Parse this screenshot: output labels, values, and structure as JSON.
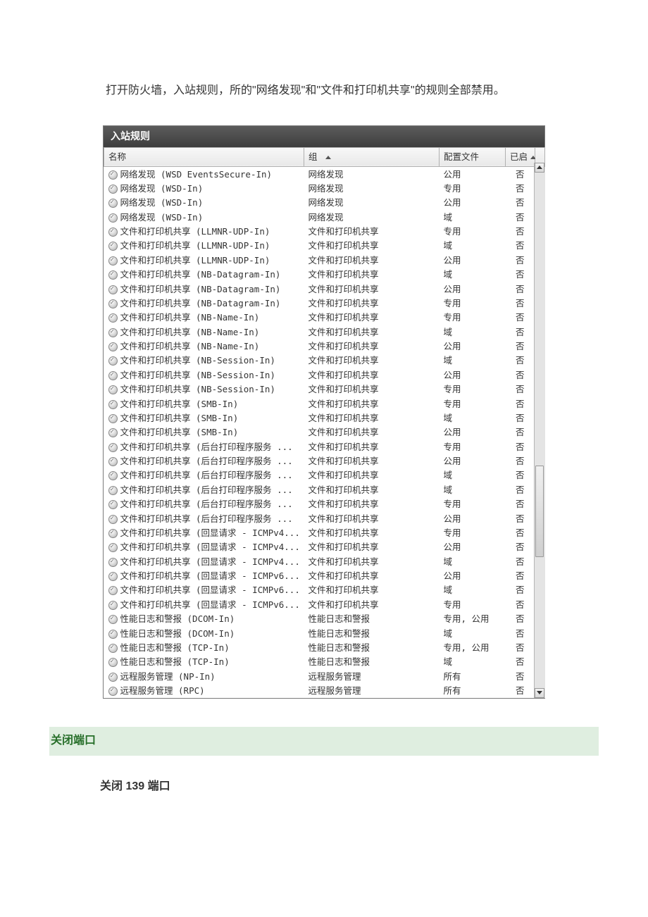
{
  "intro": "打开防火墙，入站规则，所的\"网络发现\"和\"文件和打印机共享\"的规则全部禁用。",
  "panelTitle": "入站规则",
  "headers": {
    "name": "名称",
    "group": "组",
    "profile": "配置文件",
    "enabled": "已启"
  },
  "rules": [
    {
      "name": "网络发现 (WSD EventsSecure-In)",
      "group": "网络发现",
      "profile": "公用",
      "enabled": "否"
    },
    {
      "name": "网络发现 (WSD-In)",
      "group": "网络发现",
      "profile": "专用",
      "enabled": "否"
    },
    {
      "name": "网络发现 (WSD-In)",
      "group": "网络发现",
      "profile": "公用",
      "enabled": "否"
    },
    {
      "name": "网络发现 (WSD-In)",
      "group": "网络发现",
      "profile": "域",
      "enabled": "否"
    },
    {
      "name": "文件和打印机共享 (LLMNR-UDP-In)",
      "group": "文件和打印机共享",
      "profile": "专用",
      "enabled": "否"
    },
    {
      "name": "文件和打印机共享 (LLMNR-UDP-In)",
      "group": "文件和打印机共享",
      "profile": "域",
      "enabled": "否"
    },
    {
      "name": "文件和打印机共享 (LLMNR-UDP-In)",
      "group": "文件和打印机共享",
      "profile": "公用",
      "enabled": "否"
    },
    {
      "name": "文件和打印机共享 (NB-Datagram-In)",
      "group": "文件和打印机共享",
      "profile": "域",
      "enabled": "否"
    },
    {
      "name": "文件和打印机共享 (NB-Datagram-In)",
      "group": "文件和打印机共享",
      "profile": "公用",
      "enabled": "否"
    },
    {
      "name": "文件和打印机共享 (NB-Datagram-In)",
      "group": "文件和打印机共享",
      "profile": "专用",
      "enabled": "否"
    },
    {
      "name": "文件和打印机共享 (NB-Name-In)",
      "group": "文件和打印机共享",
      "profile": "专用",
      "enabled": "否"
    },
    {
      "name": "文件和打印机共享 (NB-Name-In)",
      "group": "文件和打印机共享",
      "profile": "域",
      "enabled": "否"
    },
    {
      "name": "文件和打印机共享 (NB-Name-In)",
      "group": "文件和打印机共享",
      "profile": "公用",
      "enabled": "否"
    },
    {
      "name": "文件和打印机共享 (NB-Session-In)",
      "group": "文件和打印机共享",
      "profile": "域",
      "enabled": "否"
    },
    {
      "name": "文件和打印机共享 (NB-Session-In)",
      "group": "文件和打印机共享",
      "profile": "公用",
      "enabled": "否"
    },
    {
      "name": "文件和打印机共享 (NB-Session-In)",
      "group": "文件和打印机共享",
      "profile": "专用",
      "enabled": "否"
    },
    {
      "name": "文件和打印机共享 (SMB-In)",
      "group": "文件和打印机共享",
      "profile": "专用",
      "enabled": "否"
    },
    {
      "name": "文件和打印机共享 (SMB-In)",
      "group": "文件和打印机共享",
      "profile": "域",
      "enabled": "否"
    },
    {
      "name": "文件和打印机共享 (SMB-In)",
      "group": "文件和打印机共享",
      "profile": "公用",
      "enabled": "否"
    },
    {
      "name": "文件和打印机共享 (后台打印程序服务 ...",
      "group": "文件和打印机共享",
      "profile": "专用",
      "enabled": "否"
    },
    {
      "name": "文件和打印机共享 (后台打印程序服务 ...",
      "group": "文件和打印机共享",
      "profile": "公用",
      "enabled": "否"
    },
    {
      "name": "文件和打印机共享 (后台打印程序服务 ...",
      "group": "文件和打印机共享",
      "profile": "域",
      "enabled": "否"
    },
    {
      "name": "文件和打印机共享 (后台打印程序服务 ...",
      "group": "文件和打印机共享",
      "profile": "域",
      "enabled": "否"
    },
    {
      "name": "文件和打印机共享 (后台打印程序服务 ...",
      "group": "文件和打印机共享",
      "profile": "专用",
      "enabled": "否"
    },
    {
      "name": "文件和打印机共享 (后台打印程序服务 ...",
      "group": "文件和打印机共享",
      "profile": "公用",
      "enabled": "否"
    },
    {
      "name": "文件和打印机共享 (回显请求 - ICMPv4...",
      "group": "文件和打印机共享",
      "profile": "专用",
      "enabled": "否"
    },
    {
      "name": "文件和打印机共享 (回显请求 - ICMPv4...",
      "group": "文件和打印机共享",
      "profile": "公用",
      "enabled": "否"
    },
    {
      "name": "文件和打印机共享 (回显请求 - ICMPv4...",
      "group": "文件和打印机共享",
      "profile": "域",
      "enabled": "否"
    },
    {
      "name": "文件和打印机共享 (回显请求 - ICMPv6...",
      "group": "文件和打印机共享",
      "profile": "公用",
      "enabled": "否"
    },
    {
      "name": "文件和打印机共享 (回显请求 - ICMPv6...",
      "group": "文件和打印机共享",
      "profile": "域",
      "enabled": "否"
    },
    {
      "name": "文件和打印机共享 (回显请求 - ICMPv6...",
      "group": "文件和打印机共享",
      "profile": "专用",
      "enabled": "否"
    },
    {
      "name": "性能日志和警报 (DCOM-In)",
      "group": "性能日志和警报",
      "profile": "专用, 公用",
      "enabled": "否"
    },
    {
      "name": "性能日志和警报 (DCOM-In)",
      "group": "性能日志和警报",
      "profile": "域",
      "enabled": "否"
    },
    {
      "name": "性能日志和警报 (TCP-In)",
      "group": "性能日志和警报",
      "profile": "专用, 公用",
      "enabled": "否"
    },
    {
      "name": "性能日志和警报 (TCP-In)",
      "group": "性能日志和警报",
      "profile": "域",
      "enabled": "否"
    },
    {
      "name": "远程服务管理 (NP-In)",
      "group": "远程服务管理",
      "profile": "所有",
      "enabled": "否"
    },
    {
      "name": "远程服务管理 (RPC)",
      "group": "远程服务管理",
      "profile": "所有",
      "enabled": "否"
    }
  ],
  "sectionHeading": "关闭端口",
  "subHeading": "关闭 139 端口"
}
